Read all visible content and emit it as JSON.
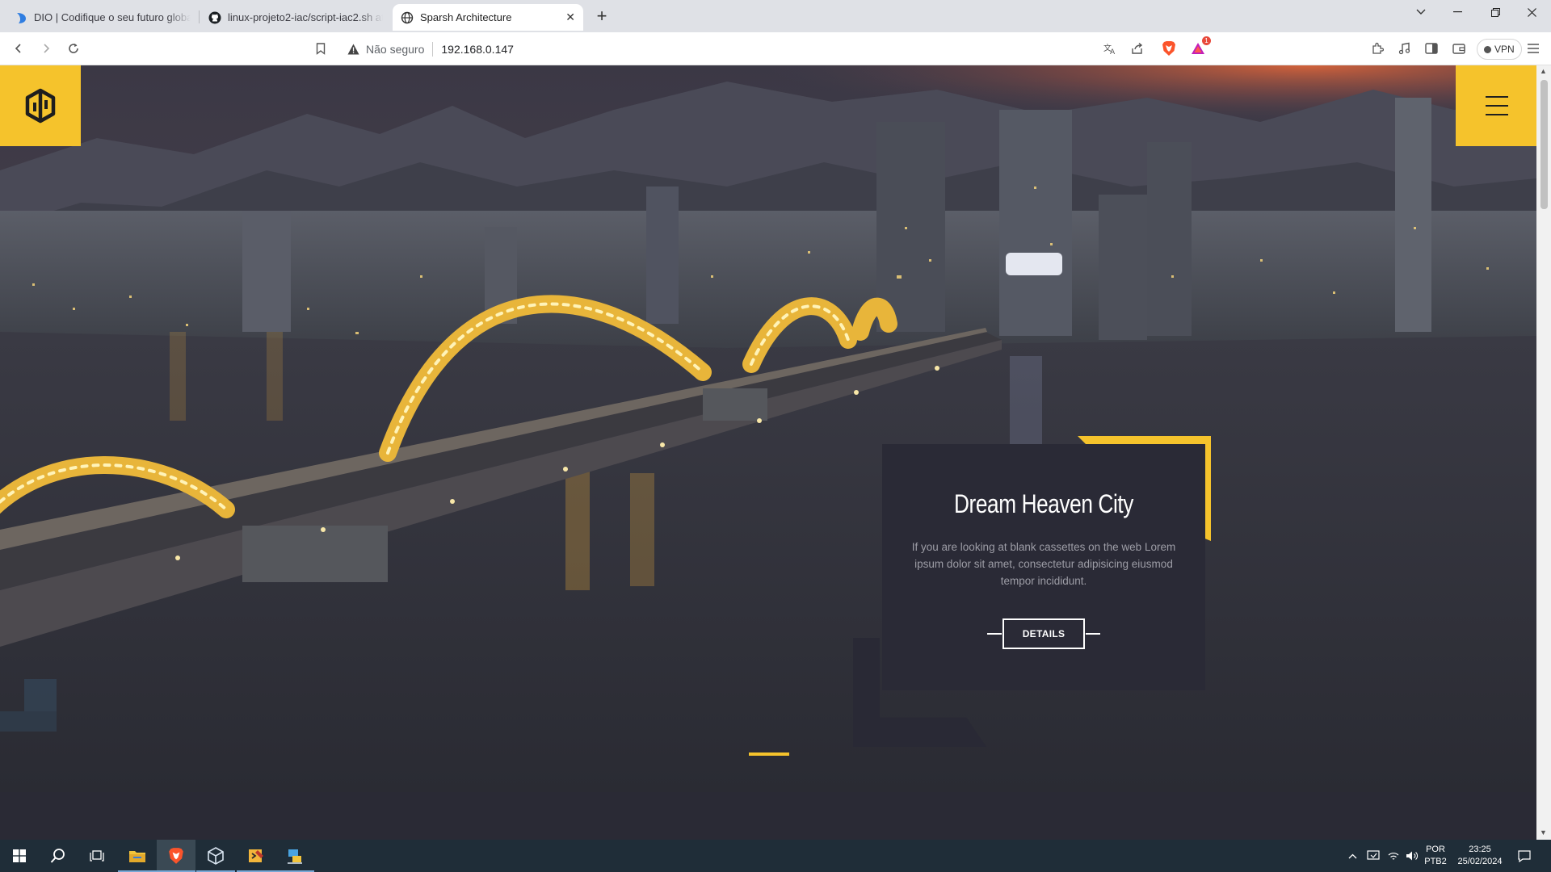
{
  "browser": {
    "tabs": [
      {
        "title": "DIO | Codifique o seu futuro global a",
        "favicon": "dio-icon"
      },
      {
        "title": "linux-projeto2-iac/script-iac2.sh at m",
        "favicon": "github-icon"
      },
      {
        "title": "Sparsh Architecture",
        "favicon": "globe-icon",
        "active": true
      }
    ],
    "security_label": "Não seguro",
    "url": "192.168.0.147",
    "vpn_label": "VPN",
    "rewards_badge": "1"
  },
  "hero": {
    "card_title": "Dream Heaven City",
    "card_text": "If you are looking at blank cassettes on the web Lorem ipsum dolor sit amet, consectetur adipisicing eiusmod tempor incididunt.",
    "button_label": "DETAILS",
    "accent_color": "#f5c32c"
  },
  "taskbar": {
    "language": "POR",
    "layout": "PTB2",
    "time": "23:25",
    "date": "25/02/2024"
  }
}
